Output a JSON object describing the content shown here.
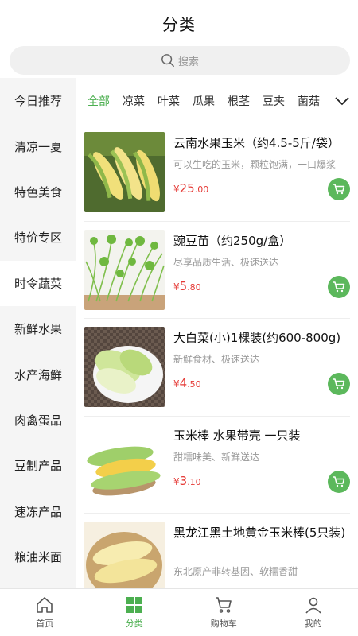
{
  "header": {
    "title": "分类"
  },
  "search": {
    "placeholder": "搜索",
    "icon": "search-icon"
  },
  "sidebar": {
    "items": [
      {
        "label": "今日推荐"
      },
      {
        "label": "清凉一夏"
      },
      {
        "label": "特色美食"
      },
      {
        "label": "特价专区"
      },
      {
        "label": "时令蔬菜",
        "active": true
      },
      {
        "label": "新鲜水果"
      },
      {
        "label": "水产海鲜"
      },
      {
        "label": "肉禽蛋品"
      },
      {
        "label": "豆制产品"
      },
      {
        "label": "速冻产品"
      },
      {
        "label": "粮油米面"
      }
    ]
  },
  "tabs": {
    "items": [
      {
        "label": "全部",
        "active": true
      },
      {
        "label": "凉菜"
      },
      {
        "label": "叶菜"
      },
      {
        "label": "瓜果"
      },
      {
        "label": "根茎"
      },
      {
        "label": "豆夹"
      },
      {
        "label": "菌菇"
      }
    ],
    "more_icon": "chevron-down-icon"
  },
  "products": [
    {
      "name": "云南水果玉米（约4.5-5斤/袋）",
      "desc": "可以生吃的玉米，颗粒饱满，一口爆浆",
      "currency": "¥",
      "price_int": "25",
      "price_dec": ".00"
    },
    {
      "name": "豌豆苗（约250g/盒）",
      "desc": "尽享品质生活、极速送达",
      "currency": "¥",
      "price_int": "5",
      "price_dec": ".80"
    },
    {
      "name": "大白菜(小)1棵装(约600-800g)",
      "desc": "新鲜食材、极速送达",
      "currency": "¥",
      "price_int": "4",
      "price_dec": ".50"
    },
    {
      "name": "玉米棒 水果带壳 一只装",
      "desc": "甜糯味美、新鲜送达",
      "currency": "¥",
      "price_int": "3",
      "price_dec": ".10"
    },
    {
      "name": "黑龙江黑土地黄金玉米棒(5只装)",
      "desc": "东北原产非转基因、软糯香甜",
      "currency": "",
      "price_int": "",
      "price_dec": ""
    }
  ],
  "tabbar": {
    "items": [
      {
        "label": "首页",
        "icon": "home-icon"
      },
      {
        "label": "分类",
        "icon": "category-icon",
        "active": true
      },
      {
        "label": "购物车",
        "icon": "cart-icon"
      },
      {
        "label": "我的",
        "icon": "user-icon"
      }
    ]
  },
  "colors": {
    "accent": "#4caf50",
    "price": "#e53935",
    "cart_button": "#5cb85c"
  }
}
